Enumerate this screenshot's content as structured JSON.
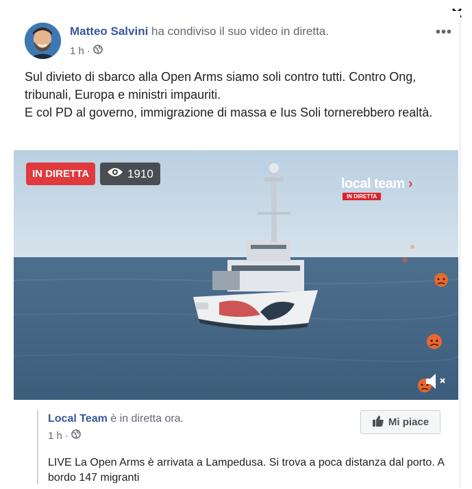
{
  "close": {
    "glyph": "✕"
  },
  "post": {
    "author": "Matteo Salvini",
    "action": "ha condiviso il suo video in diretta.",
    "time": "1 h",
    "more": "•••",
    "text_lines": [
      "Sul divieto di sbarco alla Open Arms siamo soli contro tutti. Contro Ong, tribunali, Europa e ministri impauriti.",
      "E col PD al governo, immigrazione di massa e Ius Soli tornerebbero realtà."
    ]
  },
  "video": {
    "live_badge": "IN DIRETTA",
    "viewers": "1910",
    "watermark": {
      "brand": "local team",
      "live": "IN DIRETTA"
    }
  },
  "shared": {
    "author": "Local Team",
    "status": "è in diretta ora.",
    "time": "1 h",
    "like_label": "Mi piace",
    "text": "LIVE La Open Arms è arrivata a Lampedusa. Si trova a poca distanza dal porto. A bordo 147 migranti"
  },
  "colors": {
    "link": "#385898",
    "live": "#e0393e",
    "meta": "#616770"
  },
  "icons": [
    "close-icon",
    "globe-icon",
    "more-icon",
    "eye-icon",
    "thumbs-up-icon",
    "mute-icon",
    "angry-reaction-icon"
  ]
}
